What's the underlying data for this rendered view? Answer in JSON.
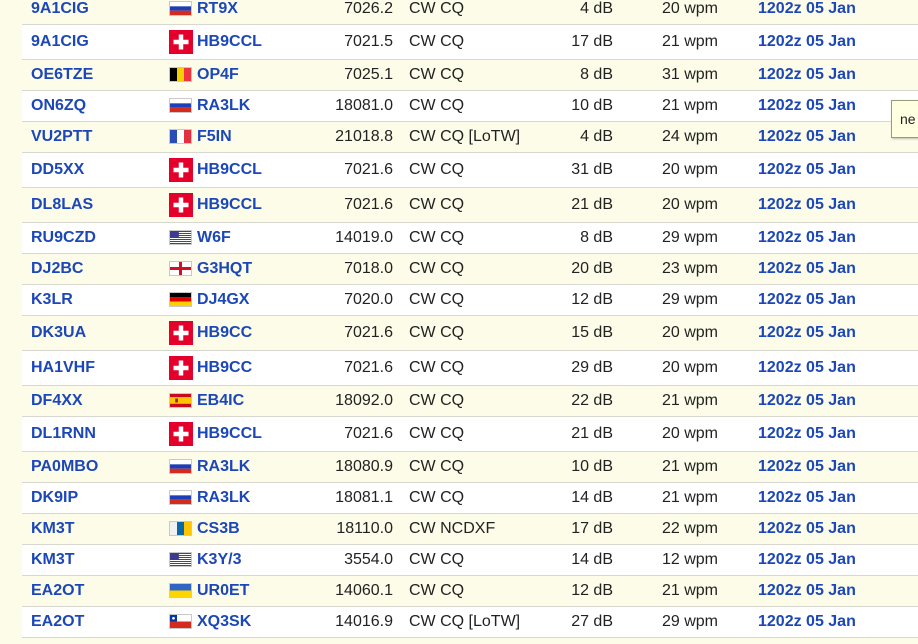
{
  "spots": [
    {
      "spotter": "9A1CIG",
      "flag": "russia",
      "dx": "RT9X",
      "freq": "7026.2",
      "mode": "CW CQ",
      "snr": "4 dB",
      "speed": "20 wpm",
      "time": "1202z 05 Jan"
    },
    {
      "spotter": "9A1CIG",
      "flag": "switzerland",
      "dx": "HB9CCL",
      "freq": "7021.5",
      "mode": "CW CQ",
      "snr": "17 dB",
      "speed": "21 wpm",
      "time": "1202z 05 Jan"
    },
    {
      "spotter": "OE6TZE",
      "flag": "belgium",
      "dx": "OP4F",
      "freq": "7025.1",
      "mode": "CW CQ",
      "snr": "8 dB",
      "speed": "31 wpm",
      "time": "1202z 05 Jan"
    },
    {
      "spotter": "ON6ZQ",
      "flag": "russia",
      "dx": "RA3LK",
      "freq": "18081.0",
      "mode": "CW CQ",
      "snr": "10 dB",
      "speed": "21 wpm",
      "time": "1202z 05 Jan"
    },
    {
      "spotter": "VU2PTT",
      "flag": "france",
      "dx": "F5IN",
      "freq": "21018.8",
      "mode": "CW CQ [LoTW]",
      "snr": "4 dB",
      "speed": "24 wpm",
      "time": "1202z 05 Jan"
    },
    {
      "spotter": "DD5XX",
      "flag": "switzerland",
      "dx": "HB9CCL",
      "freq": "7021.6",
      "mode": "CW CQ",
      "snr": "31 dB",
      "speed": "20 wpm",
      "time": "1202z 05 Jan"
    },
    {
      "spotter": "DL8LAS",
      "flag": "switzerland",
      "dx": "HB9CCL",
      "freq": "7021.6",
      "mode": "CW CQ",
      "snr": "21 dB",
      "speed": "20 wpm",
      "time": "1202z 05 Jan"
    },
    {
      "spotter": "RU9CZD",
      "flag": "usa",
      "dx": "W6F",
      "freq": "14019.0",
      "mode": "CW CQ",
      "snr": "8 dB",
      "speed": "29 wpm",
      "time": "1202z 05 Jan"
    },
    {
      "spotter": "DJ2BC",
      "flag": "england",
      "dx": "G3HQT",
      "freq": "7018.0",
      "mode": "CW CQ",
      "snr": "20 dB",
      "speed": "23 wpm",
      "time": "1202z 05 Jan"
    },
    {
      "spotter": "K3LR",
      "flag": "germany",
      "dx": "DJ4GX",
      "freq": "7020.0",
      "mode": "CW CQ",
      "snr": "12 dB",
      "speed": "29 wpm",
      "time": "1202z 05 Jan"
    },
    {
      "spotter": "DK3UA",
      "flag": "switzerland",
      "dx": "HB9CC",
      "freq": "7021.6",
      "mode": "CW CQ",
      "snr": "15 dB",
      "speed": "20 wpm",
      "time": "1202z 05 Jan"
    },
    {
      "spotter": "HA1VHF",
      "flag": "switzerland",
      "dx": "HB9CC",
      "freq": "7021.6",
      "mode": "CW CQ",
      "snr": "29 dB",
      "speed": "20 wpm",
      "time": "1202z 05 Jan"
    },
    {
      "spotter": "DF4XX",
      "flag": "spain",
      "dx": "EB4IC",
      "freq": "18092.0",
      "mode": "CW CQ",
      "snr": "22 dB",
      "speed": "21 wpm",
      "time": "1202z 05 Jan"
    },
    {
      "spotter": "DL1RNN",
      "flag": "switzerland",
      "dx": "HB9CCL",
      "freq": "7021.6",
      "mode": "CW CQ",
      "snr": "21 dB",
      "speed": "20 wpm",
      "time": "1202z 05 Jan"
    },
    {
      "spotter": "PA0MBO",
      "flag": "russia",
      "dx": "RA3LK",
      "freq": "18080.9",
      "mode": "CW CQ",
      "snr": "10 dB",
      "speed": "21 wpm",
      "time": "1202z 05 Jan"
    },
    {
      "spotter": "DK9IP",
      "flag": "russia",
      "dx": "RA3LK",
      "freq": "18081.1",
      "mode": "CW CQ",
      "snr": "14 dB",
      "speed": "21 wpm",
      "time": "1202z 05 Jan"
    },
    {
      "spotter": "KM3T",
      "flag": "canary-islands",
      "dx": "CS3B",
      "freq": "18110.0",
      "mode": "CW NCDXF",
      "snr": "17 dB",
      "speed": "22 wpm",
      "time": "1202z 05 Jan"
    },
    {
      "spotter": "KM3T",
      "flag": "usa",
      "dx": "K3Y/3",
      "freq": "3554.0",
      "mode": "CW CQ",
      "snr": "14 dB",
      "speed": "12 wpm",
      "time": "1202z 05 Jan"
    },
    {
      "spotter": "EA2OT",
      "flag": "ukraine",
      "dx": "UR0ET",
      "freq": "14060.1",
      "mode": "CW CQ",
      "snr": "12 dB",
      "speed": "21 wpm",
      "time": "1202z 05 Jan"
    },
    {
      "spotter": "EA2OT",
      "flag": "chile",
      "dx": "XQ3SK",
      "freq": "14016.9",
      "mode": "CW CQ [LoTW]",
      "snr": "27 dB",
      "speed": "29 wpm",
      "time": "1202z 05 Jan"
    }
  ],
  "tooltip": {
    "text": "ne"
  },
  "colors": {
    "link": "#1c47b8",
    "background": "#fcfce8",
    "row_alt": "#ffffff"
  }
}
